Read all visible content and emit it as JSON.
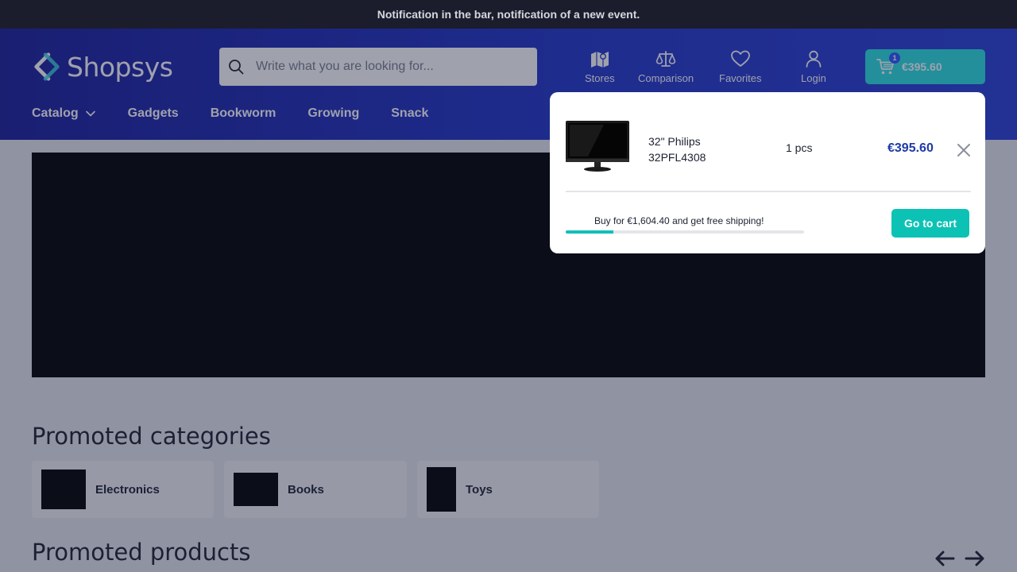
{
  "notification_bar": {
    "text": "Notification in the bar, notification of a new event."
  },
  "header": {
    "logo_text": "Shopsys",
    "search": {
      "placeholder": "Write what you are looking for...",
      "value": ""
    },
    "buttons": [
      {
        "label": "Stores",
        "icon": "map-icon"
      },
      {
        "label": "Comparison",
        "icon": "scales-icon"
      },
      {
        "label": "Favorites",
        "icon": "heart-icon"
      },
      {
        "label": "Login",
        "icon": "user-icon"
      }
    ],
    "cart": {
      "count": "1",
      "price": "€395.60",
      "icon": "cart-icon"
    }
  },
  "nav": {
    "items": [
      {
        "label": "Catalog",
        "has_dropdown": true
      },
      {
        "label": "Gadgets"
      },
      {
        "label": "Bookworm"
      },
      {
        "label": "Growing"
      },
      {
        "label": "Snack"
      }
    ]
  },
  "promoted_categories": {
    "title": "Promoted categories",
    "items": [
      {
        "name": "Electronics"
      },
      {
        "name": "Books"
      },
      {
        "name": "Toys"
      }
    ]
  },
  "promoted_products": {
    "title": "Promoted products"
  },
  "cart_popup": {
    "item": {
      "name": "32\" Philips 32PFL4308",
      "quantity": "1 pcs",
      "price": "€395.60"
    },
    "free_shipping_text": "Buy for €1,604.40 and get free shipping!",
    "free_shipping_progress": 0.2,
    "go_to_cart_label": "Go to cart"
  },
  "colors": {
    "notification_bg": "#1b1d2c",
    "header_gradient_start": "#1a1f9a",
    "header_gradient_end": "#2a3fd6",
    "cart_button": "#28e0e0",
    "accent_teal": "#0cc2b5",
    "price_blue": "#1e3aa8"
  }
}
